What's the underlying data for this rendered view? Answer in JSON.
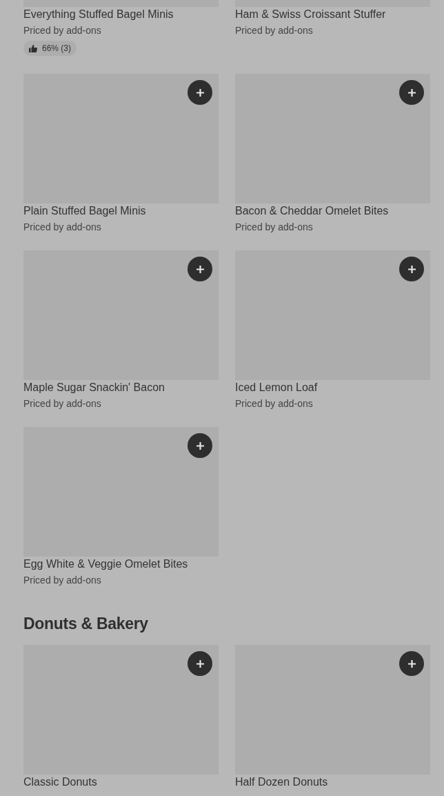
{
  "sections": [
    {
      "items": [
        {
          "name": "Everything Stuffed Bagel Minis",
          "price": "Priced by add-ons",
          "rating": "66% (3)",
          "add_button": false
        },
        {
          "name": "Ham & Swiss Croissant Stuffer",
          "price": "Priced by add-ons",
          "add_button": false
        },
        {
          "name": "Plain Stuffed Bagel Minis",
          "price": "Priced by add-ons"
        },
        {
          "name": "Bacon & Cheddar Omelet Bites",
          "price": "Priced by add-ons"
        },
        {
          "name": "Maple Sugar Snackin' Bacon",
          "price": "Priced by add-ons"
        },
        {
          "name": "Iced Lemon Loaf",
          "price": "Priced by add-ons"
        },
        {
          "name": "Egg White & Veggie Omelet Bites",
          "price": "Priced by add-ons"
        }
      ]
    },
    {
      "heading": "Donuts & Bakery",
      "items": [
        {
          "name": "Classic Donuts"
        },
        {
          "name": "Half Dozen Donuts"
        }
      ]
    }
  ]
}
